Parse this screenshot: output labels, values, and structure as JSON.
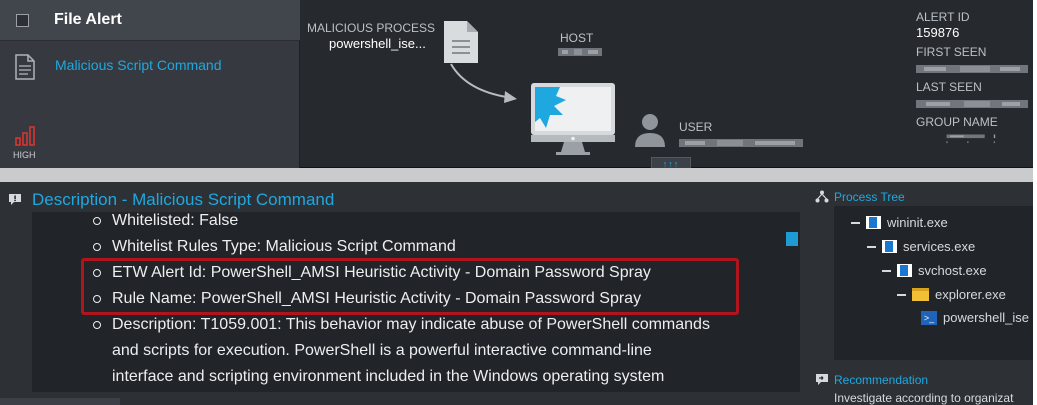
{
  "alert": {
    "type": "File Alert",
    "name": "Malicious Script Command",
    "severity": "HIGH"
  },
  "process": {
    "label": "MALICIOUS PROCESS",
    "value": "powershell_ise..."
  },
  "host": {
    "label": "HOST"
  },
  "user": {
    "label": "USER",
    "expand": "↑↑↑"
  },
  "meta": {
    "alert_id_label": "ALERT ID",
    "alert_id": "159876",
    "first_seen_label": "FIRST SEEN",
    "last_seen_label": "LAST SEEN",
    "group_name_label": "GROUP NAME"
  },
  "description": {
    "title": "Description - Malicious Script Command",
    "items": [
      "Whitelisted: False",
      "Whitelist Rules Type: Malicious Script Command",
      "ETW Alert Id: PowerShell_AMSI Heuristic Activity - Domain Password Spray",
      "Rule Name: PowerShell_AMSI Heuristic Activity - Domain Password Spray",
      "Description: T1059.001: This behavior may indicate abuse of PowerShell commands"
    ],
    "continuation": [
      "and scripts for execution. PowerShell is a powerful interactive command-line",
      "interface and scripting environment included in the Windows operating system"
    ]
  },
  "process_tree": {
    "title": "Process Tree",
    "nodes": [
      {
        "label": "wininit.exe",
        "icon": "windows-app-icon"
      },
      {
        "label": "services.exe",
        "icon": "windows-app-icon"
      },
      {
        "label": "svchost.exe",
        "icon": "windows-app-icon"
      },
      {
        "label": "explorer.exe",
        "icon": "folder-icon"
      },
      {
        "label": "powershell_ise",
        "icon": "powershell-icon"
      }
    ]
  },
  "recommendation": {
    "title": "Recommendation",
    "text": "Investigate according to organizat"
  },
  "colors": {
    "accent": "#1fa8e0",
    "highlight": "#b0141c",
    "panel": "#26292e"
  }
}
